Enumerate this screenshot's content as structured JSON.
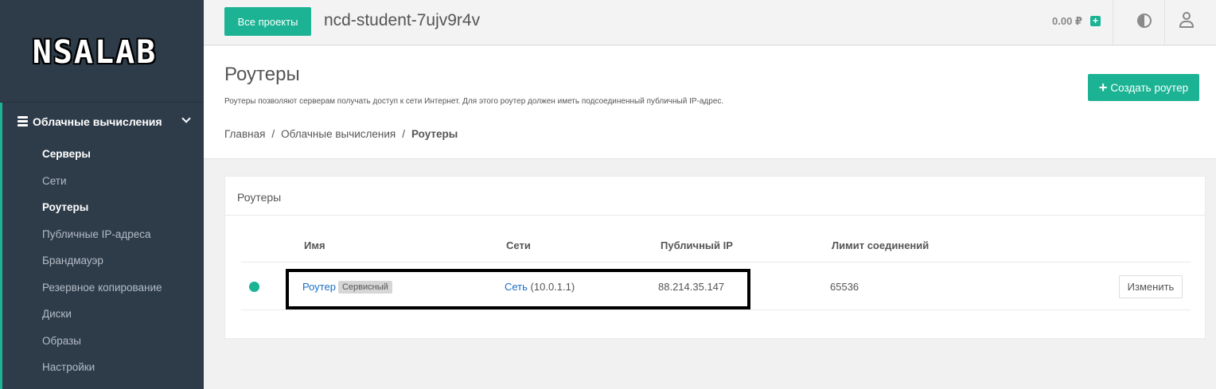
{
  "sidebar": {
    "logo": "NSALAB",
    "section_label": "Облачные вычисления",
    "items": [
      {
        "label": "Серверы",
        "active": true
      },
      {
        "label": "Сети",
        "active": false
      },
      {
        "label": "Роутеры",
        "active": true
      },
      {
        "label": "Публичные IP-адреса",
        "active": false
      },
      {
        "label": "Брандмауэр",
        "active": false
      },
      {
        "label": "Резервное копирование",
        "active": false
      },
      {
        "label": "Диски",
        "active": false
      },
      {
        "label": "Образы",
        "active": false
      },
      {
        "label": "Настройки",
        "active": false
      }
    ]
  },
  "topbar": {
    "projects_button": "Все проекты",
    "project_name": "ncd-student-7ujv9r4v",
    "balance": "0.00 ₽",
    "add_funds": "+"
  },
  "page": {
    "title": "Роутеры",
    "description": "Роутеры позволяют серверам получать доступ к сети Интернет. Для этого роутер должен иметь подсоединенный публичный IP-адрес.",
    "create_button": "Создать роутер",
    "breadcrumb": [
      "Главная",
      "Облачные вычисления",
      "Роутеры"
    ]
  },
  "card": {
    "title": "Роутеры",
    "columns": [
      "Имя",
      "Сети",
      "Публичный IP",
      "Лимит соединений"
    ],
    "rows": [
      {
        "name": "Роутер",
        "badge": "Сервисный",
        "network_link": "Сеть",
        "network_cidr": "(10.0.1.1)",
        "public_ip": "88.214.35.147",
        "conn_limit": "65536",
        "edit_button": "Изменить"
      }
    ]
  },
  "colors": {
    "accent": "#1bb394",
    "sidebar_bg": "#2e3c4a",
    "link": "#1a6fc4"
  }
}
